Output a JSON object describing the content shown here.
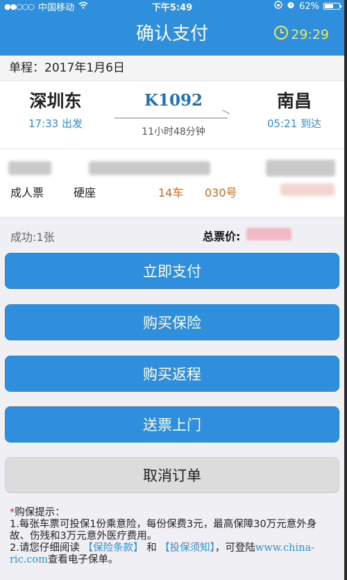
{
  "status_bar": {
    "carrier": "中国移动",
    "signal": "●●○○○",
    "time": "下午5:49",
    "battery": "62%",
    "battery_level": 0.62
  },
  "nav": {
    "title": "确认支付",
    "timer": "29:29"
  },
  "trip": {
    "date_label": "单程：2017年1月6日"
  },
  "train": {
    "from_station": "深圳东",
    "from_time": "17:33 出发",
    "train_no": "K1092",
    "duration": "11小时48分钟",
    "to_station": "南昌",
    "to_time": "05:21 到达"
  },
  "passenger": {
    "ticket_type": "成人票",
    "seat_class": "硬座",
    "car": "14车",
    "seat_no": "030号"
  },
  "summary": {
    "success": "成功:1张",
    "total_label": "总票价:"
  },
  "buttons": {
    "pay": "立即支付",
    "insurance": "购买保险",
    "return_trip": "购买返程",
    "delivery": "送票上门",
    "cancel": "取消订单"
  },
  "tips": {
    "star": "*",
    "title": "购保提示：",
    "line1": "1.每张车票可投保1份乘意险，每份保费3元，最高保障30万元意外身故、伤残和3万元意外医疗费用。",
    "line2_prefix": "2.请您仔细阅读",
    "terms_link": "【保险条款】",
    "and": "和",
    "notice_link": "【投保须知】",
    "line2_mid": "，可登陆",
    "url": "www.china-ric.com",
    "line2_suffix": "查看电子保单。"
  },
  "colors": {
    "primary": "#2f8fdc",
    "timer": "#f4e94a",
    "accent_orange": "#d2691e",
    "cancel_bg": "#dcdcdc"
  }
}
